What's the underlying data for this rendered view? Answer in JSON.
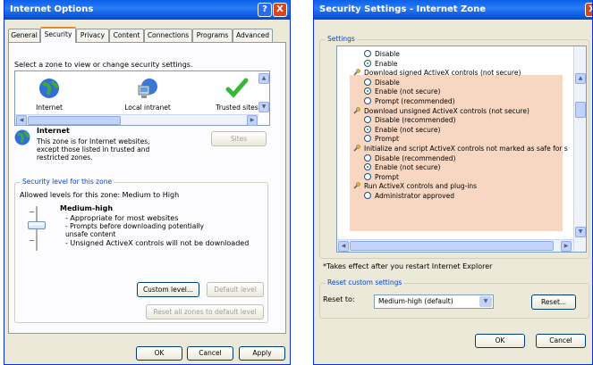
{
  "internet_options": {
    "title": "Internet Options",
    "help_button": "?",
    "close_button": "X",
    "tabs": [
      "General",
      "Security",
      "Privacy",
      "Content",
      "Connections",
      "Programs",
      "Advanced"
    ],
    "zone_prompt": "Select a zone to view or change security settings.",
    "zones": [
      "Internet",
      "Local intranet",
      "Trusted sites"
    ],
    "selected_zone": {
      "name": "Internet",
      "description": "This zone is for Internet websites, except those listed in trusted and restricted zones."
    },
    "sites_button": "Sites",
    "security_level": {
      "legend": "Security level for this zone",
      "allowed": "Allowed levels for this zone: Medium to High",
      "level_name": "Medium-high",
      "bullets": [
        "- Appropriate for most websites",
        "- Prompts before downloading potentially unsafe content",
        "- Unsigned ActiveX controls will not be downloaded"
      ],
      "custom_button": "Custom level...",
      "default_button": "Default level",
      "reset_all_button": "Reset all zones to default level"
    },
    "footer": {
      "ok": "OK",
      "cancel": "Cancel",
      "apply": "Apply"
    }
  },
  "security_settings": {
    "title": "Security Settings - Internet Zone",
    "settings_legend": "Settings",
    "rows": [
      {
        "kind": "radio",
        "label": "Disable",
        "checked": false
      },
      {
        "kind": "radio",
        "label": "Enable",
        "checked": true
      },
      {
        "kind": "group",
        "label": "Download signed ActiveX controls (not secure)"
      },
      {
        "kind": "radio",
        "label": "Disable",
        "checked": false
      },
      {
        "kind": "radio",
        "label": "Enable (not secure)",
        "checked": true
      },
      {
        "kind": "radio",
        "label": "Prompt (recommended)",
        "checked": false
      },
      {
        "kind": "group",
        "label": "Download unsigned ActiveX controls (not secure)"
      },
      {
        "kind": "radio",
        "label": "Disable (recommended)",
        "checked": false
      },
      {
        "kind": "radio",
        "label": "Enable (not secure)",
        "checked": true
      },
      {
        "kind": "radio",
        "label": "Prompt",
        "checked": false
      },
      {
        "kind": "group",
        "label": "Initialize and script ActiveX controls not marked as safe for s"
      },
      {
        "kind": "radio",
        "label": "Disable (recommended)",
        "checked": false
      },
      {
        "kind": "radio",
        "label": "Enable (not secure)",
        "checked": true
      },
      {
        "kind": "radio",
        "label": "Prompt",
        "checked": false
      },
      {
        "kind": "group",
        "label": "Run ActiveX controls and plug-ins"
      },
      {
        "kind": "radio",
        "label": "Administrator approved",
        "checked": false
      }
    ],
    "note": "*Takes effect after you restart Internet Explorer",
    "reset_legend": "Reset custom settings",
    "reset_to_label": "Reset to:",
    "reset_to_value": "Medium-high (default)",
    "reset_button": "Reset...",
    "ok": "OK",
    "cancel": "Cancel"
  },
  "colors": {
    "titlebar": "#0a5fe8",
    "window_bg": "#ece9d8",
    "highlight_rows": "#f7d7c2",
    "accent_blue": "#0046d5",
    "radio_dot": "#21a121"
  }
}
